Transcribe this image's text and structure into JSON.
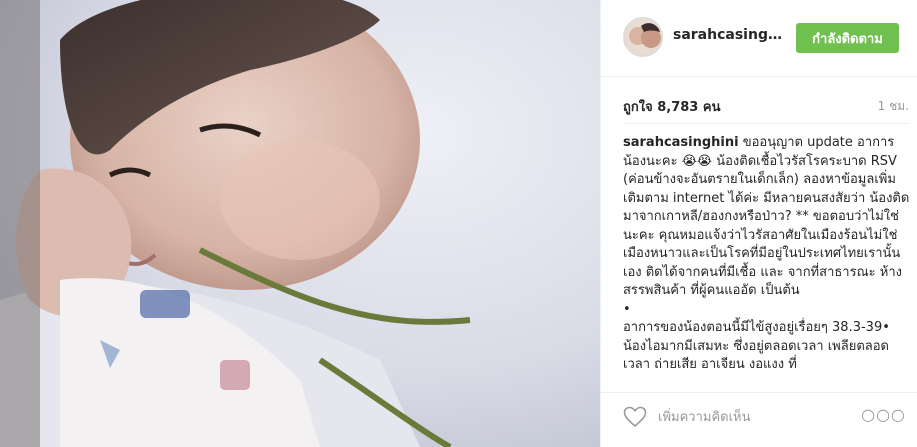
{
  "post": {
    "username": "sarahcasinghi...",
    "follow_label": "กำลังติดตาม",
    "likes": "ถูกใจ 8,783 คน",
    "time": "1 ชม.",
    "caption_user": "sarahcasinghini",
    "caption_text": " ขออนุญาต update อาการน้องนะคะ 😭😭 น้องติดเชื้อไวรัสโรคระบาด RSV (ค่อนข้างจะอันตรายในเด็กเล็ก) ลองหาข้อมูลเพิ่มเติมตาม internet ได้ค่ะ มีหลายคนสงสัยว่า น้องติดมาจากเกาหลี/ฮองกงหรือป่าว? ** ขอตอบว่าไม่ใช่นะคะ คุณหมอแจ้งว่าไวรัสอาศัยในเมืองร้อนไม่ใช่เมืองหนาวและเป็นโรคที่มีอยู่ในประเทศไทยเรานั้นเอง ติดได้จากคนที่มีเชื้อ และ จากที่สาธารณะ ห้างสรรพสินค้า ที่ผู้คนแออัด เป็นต้น\n•\nอาการของน้องตอนนี้มีไข้สูงอยู่เรื่อยๆ 38.3-39• น้องไอมากมีเสมหะ ซึ่งอยู่ตลอดเวลา เพลียตลอดเวลา ถ่ายเสีย อาเจียน งอแงง ที่"
  },
  "footer": {
    "comment_placeholder": "เพิ่มความคิดเห็น",
    "more_label": "○○○"
  },
  "icons": {
    "like": "heart-icon",
    "more": "more-options-icon"
  },
  "colors": {
    "follow_button": "#70c050",
    "divider": "#efefef"
  }
}
